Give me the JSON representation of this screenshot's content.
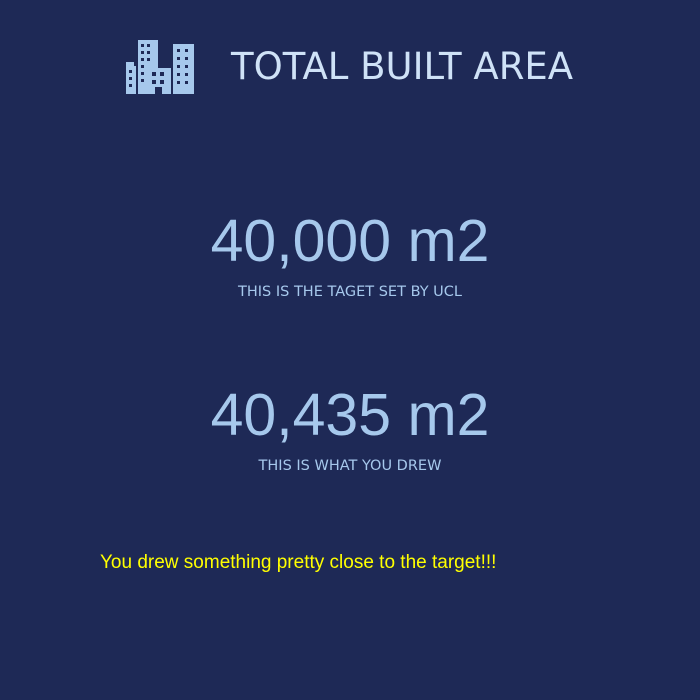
{
  "header": {
    "icon": "buildings-icon",
    "title": "TOTAL BUILT AREA"
  },
  "target": {
    "value": "40,000 m2",
    "caption": "THIS IS THE TAGET SET BY UCL"
  },
  "drawn": {
    "value": "40,435 m2",
    "caption": "THIS IS WHAT YOU DREW"
  },
  "feedback": {
    "message": "You drew something pretty close to the target!!!"
  },
  "colors": {
    "background": "#1e2956",
    "title": "#cfe2f7",
    "metric": "#a6c8ec",
    "message": "#ffff00"
  }
}
